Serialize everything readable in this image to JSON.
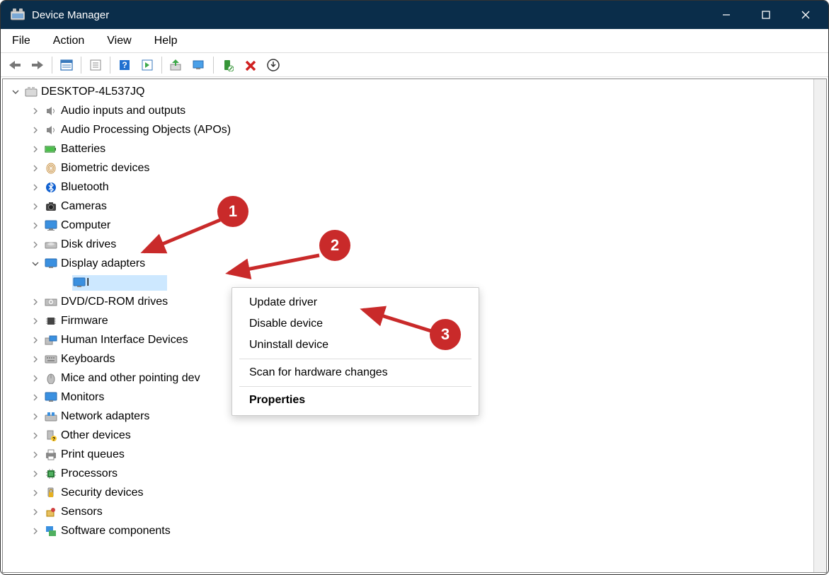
{
  "window": {
    "title": "Device Manager"
  },
  "menu": {
    "file": "File",
    "action": "Action",
    "view": "View",
    "help": "Help"
  },
  "tree": {
    "root": "DESKTOP-4L537JQ",
    "items": [
      {
        "label": "Audio inputs and outputs",
        "icon": "speaker"
      },
      {
        "label": "Audio Processing Objects (APOs)",
        "icon": "speaker"
      },
      {
        "label": "Batteries",
        "icon": "battery"
      },
      {
        "label": "Biometric devices",
        "icon": "fingerprint"
      },
      {
        "label": "Bluetooth",
        "icon": "bluetooth"
      },
      {
        "label": "Cameras",
        "icon": "camera"
      },
      {
        "label": "Computer",
        "icon": "monitor"
      },
      {
        "label": "Disk drives",
        "icon": "disk"
      },
      {
        "label": "Display adapters",
        "icon": "monitor",
        "expanded": true,
        "children": [
          {
            "label": "I",
            "icon": "monitor",
            "selected": true
          }
        ]
      },
      {
        "label": "DVD/CD-ROM drives",
        "icon": "cd"
      },
      {
        "label": "Firmware",
        "icon": "chip"
      },
      {
        "label": "Human Interface Devices",
        "icon": "hid"
      },
      {
        "label": "Keyboards",
        "icon": "keyboard"
      },
      {
        "label": "Mice and other pointing dev",
        "icon": "mouse"
      },
      {
        "label": "Monitors",
        "icon": "monitor"
      },
      {
        "label": "Network adapters",
        "icon": "network"
      },
      {
        "label": "Other devices",
        "icon": "other"
      },
      {
        "label": "Print queues",
        "icon": "printer"
      },
      {
        "label": "Processors",
        "icon": "cpu"
      },
      {
        "label": "Security devices",
        "icon": "security"
      },
      {
        "label": "Sensors",
        "icon": "sensor"
      },
      {
        "label": "Software components",
        "icon": "software"
      }
    ]
  },
  "context_menu": {
    "update": "Update driver",
    "disable": "Disable device",
    "uninstall": "Uninstall device",
    "scan": "Scan for hardware changes",
    "properties": "Properties"
  },
  "annotations": {
    "c1": "1",
    "c2": "2",
    "c3": "3"
  }
}
